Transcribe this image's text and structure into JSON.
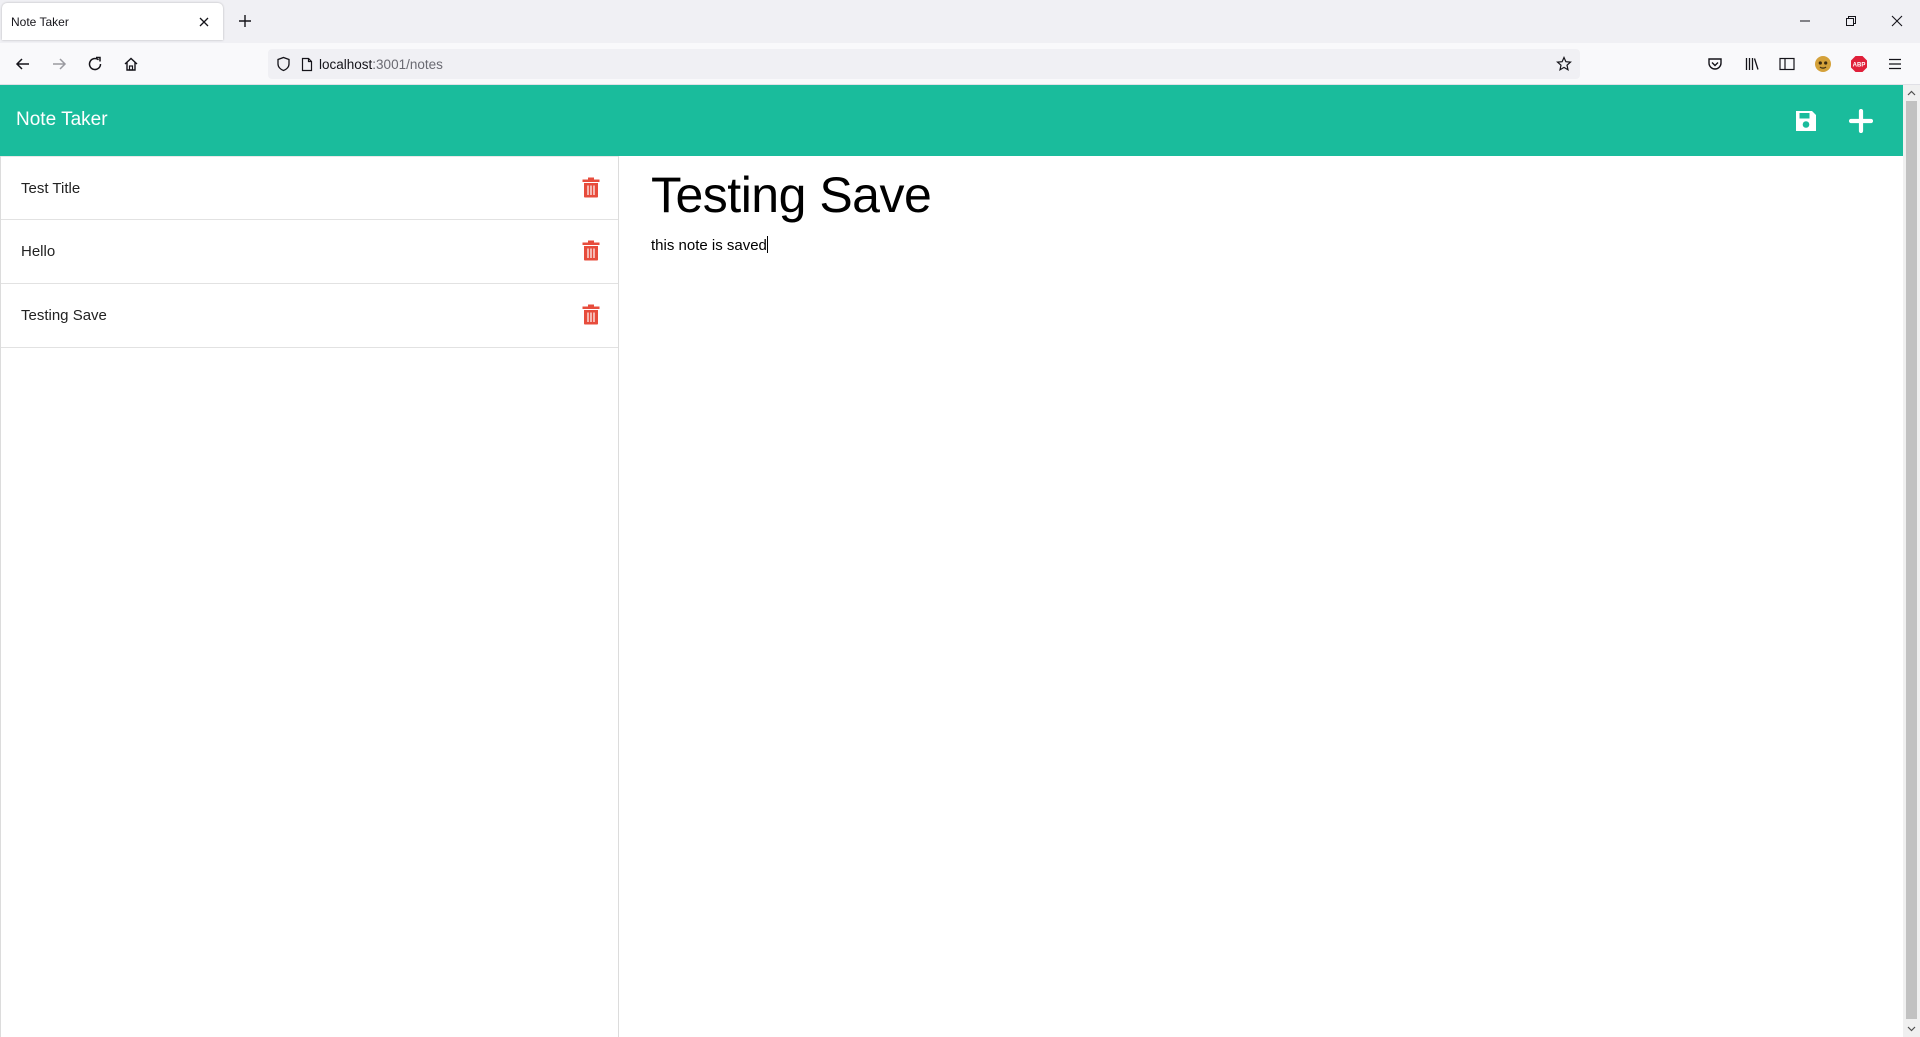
{
  "browser": {
    "tab_title": "Note Taker",
    "url_host": "localhost",
    "url_path": ":3001/notes"
  },
  "app": {
    "brand": "Note Taker",
    "header_color": "#1abc9c",
    "delete_color": "#e74c3c"
  },
  "notes": [
    {
      "title": "Test Title"
    },
    {
      "title": "Hello"
    },
    {
      "title": "Testing Save"
    }
  ],
  "active_note": {
    "title": "Testing Save",
    "text": "this note is saved"
  },
  "icons": {
    "save": "floppy-disk-icon",
    "new": "plus-icon",
    "delete": "trash-icon"
  }
}
